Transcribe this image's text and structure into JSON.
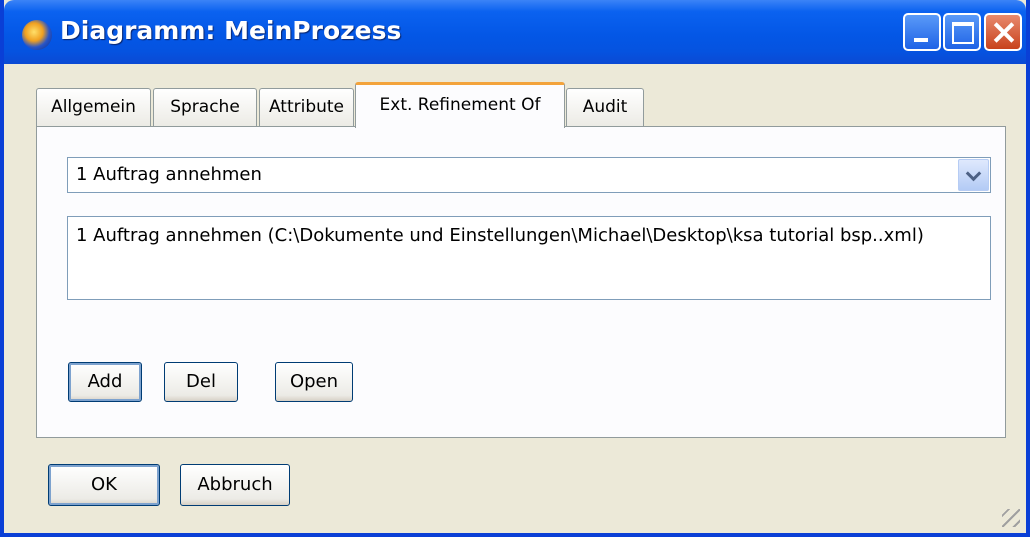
{
  "window": {
    "title": "Diagramm: MeinProzess"
  },
  "titlebar": {
    "icon": "app-icon",
    "controls": [
      "minimize-icon",
      "maximize-icon",
      "close-icon"
    ]
  },
  "tabs": [
    {
      "label": "Allgemein",
      "active": false
    },
    {
      "label": "Sprache",
      "active": false
    },
    {
      "label": "Attribute",
      "active": false
    },
    {
      "label": "Ext. Refinement Of",
      "active": true
    },
    {
      "label": "Audit",
      "active": false
    }
  ],
  "refinement": {
    "selected": "1 Auftrag annehmen",
    "list_items": [
      "1 Auftrag annehmen (C:\\Dokumente und Einstellungen\\Michael\\Desktop\\ksa tutorial bsp..xml)"
    ]
  },
  "buttons": {
    "add": "Add",
    "del": "Del",
    "open": "Open",
    "ok": "OK",
    "cancel": "Abbruch"
  }
}
